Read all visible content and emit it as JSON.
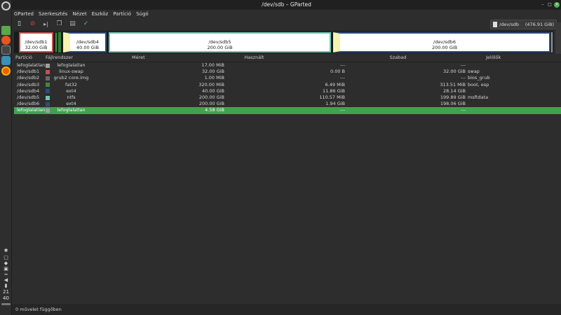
{
  "window": {
    "title": "/dev/sdb – GParted"
  },
  "menu": [
    "GParted",
    "Szerkesztés",
    "Nézet",
    "Eszköz",
    "Partíció",
    "Súgó"
  ],
  "device": {
    "name": "/dev/sdb",
    "size": "(476.91 GiB)"
  },
  "map": {
    "sdb1": {
      "name": "/dev/sdb1",
      "size": "32.00 GiB"
    },
    "sdb4": {
      "name": "/dev/sdb4",
      "size": "40.00 GiB"
    },
    "sdb5": {
      "name": "/dev/sdb5",
      "size": "200.00 GiB"
    },
    "sdb6": {
      "name": "/dev/sdb6",
      "size": "200.00 GiB"
    }
  },
  "table": {
    "headers": {
      "partition": "Partíció",
      "fs": "Fájlrendszer",
      "size": "Méret",
      "used": "Használt",
      "free": "Szabad",
      "flags": "Jelölők"
    },
    "rows": [
      {
        "partition": "lefoglalatlan",
        "fs": "lefoglalatlan",
        "size": "17.00 MiB",
        "used": "---",
        "free": "---",
        "flags": "",
        "color": "#a0a0a0"
      },
      {
        "partition": "/dev/sdb1",
        "fs": "linux-swap",
        "size": "32.00 GiB",
        "used": "0.00 B",
        "free": "32.00 GiB",
        "flags": "swap",
        "color": "#c8504b"
      },
      {
        "partition": "/dev/sdb2",
        "fs": "grub2 core.img",
        "size": "1.00 MiB",
        "used": "---",
        "free": "---",
        "flags": "bios_grub",
        "color": "#6a6a6a"
      },
      {
        "partition": "/dev/sdb3",
        "fs": "fat32",
        "size": "320.00 MiB",
        "used": "6.49 MiB",
        "free": "313.51 MiB",
        "flags": "boot, esp",
        "color": "#3d8b3d"
      },
      {
        "partition": "/dev/sdb4",
        "fs": "ext4",
        "size": "40.00 GiB",
        "used": "11.86 GiB",
        "free": "28.14 GiB",
        "flags": "",
        "color": "#2e4d7a"
      },
      {
        "partition": "/dev/sdb5",
        "fs": "ntfs",
        "size": "200.00 GiB",
        "used": "110.57 MiB",
        "free": "199.89 GiB",
        "flags": "msftdata",
        "color": "#6fc6ae"
      },
      {
        "partition": "/dev/sdb6",
        "fs": "ext4",
        "size": "200.00 GiB",
        "used": "1.94 GiB",
        "free": "198.06 GiB",
        "flags": "",
        "color": "#2e4d7a"
      },
      {
        "partition": "lefoglalatlan",
        "fs": "lefoglalatlan",
        "size": "4.58 GiB",
        "used": "---",
        "free": "---",
        "flags": "",
        "color": "#a0a0a0",
        "selected": true
      }
    ]
  },
  "status": {
    "text": "0 művelet függőben"
  },
  "clock": {
    "hours": "21",
    "minutes": "40"
  }
}
